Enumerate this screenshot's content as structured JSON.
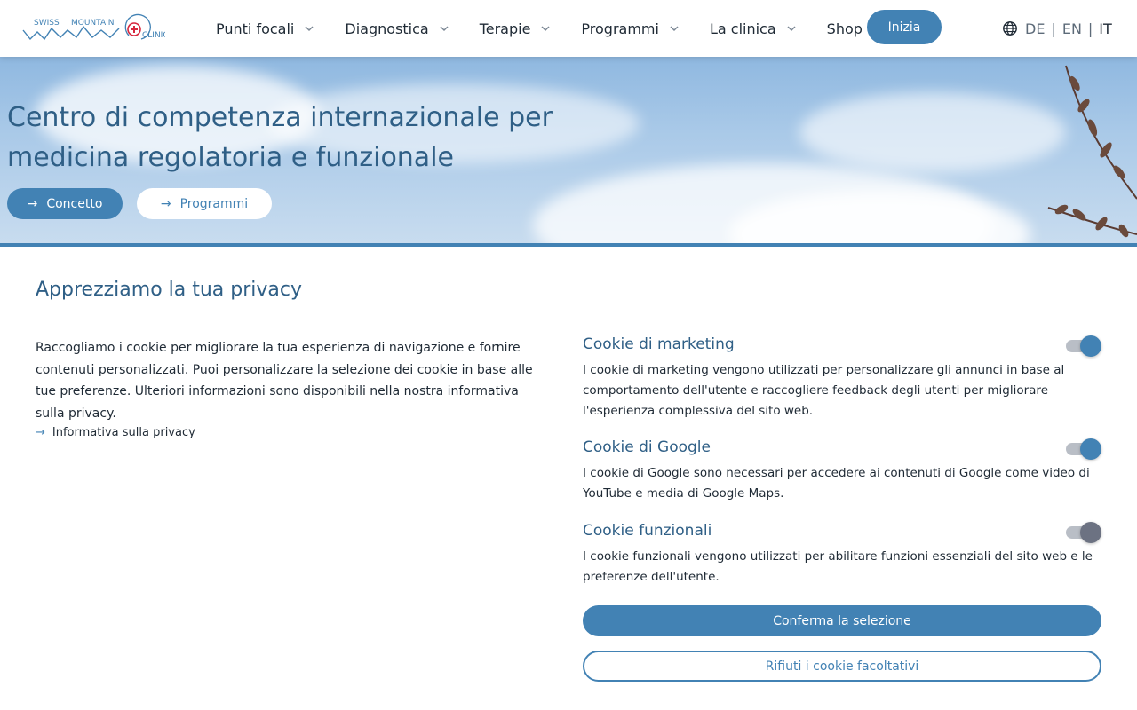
{
  "logo": {
    "text_parts": [
      "SWISS",
      "MOUNTAIN",
      "CLINIC"
    ]
  },
  "nav": {
    "items": [
      {
        "label": "Punti focali",
        "has_dropdown": true
      },
      {
        "label": "Diagnostica",
        "has_dropdown": true
      },
      {
        "label": "Terapie",
        "has_dropdown": true
      },
      {
        "label": "Programmi",
        "has_dropdown": true
      },
      {
        "label": "La clinica",
        "has_dropdown": true
      },
      {
        "label": "Shop",
        "has_dropdown": false
      }
    ],
    "start_label": "Inizia"
  },
  "lang": {
    "options": [
      "DE",
      "EN",
      "IT"
    ],
    "active": "IT",
    "separator": "|"
  },
  "hero": {
    "title": "Centro di competenza internazionale per medicina regolatoria e funzionale",
    "primary_button": "Concetto",
    "secondary_button": "Programmi"
  },
  "privacy": {
    "title": "Apprezziamo la tua privacy",
    "text": "Raccogliamo i cookie per migliorare la tua esperienza di navigazione e fornire contenuti personalizzati. Puoi personalizzare la selezione dei cookie in base alle tue preferenze. Ulteriori informazioni sono disponibili nella nostra informativa sulla privacy.",
    "link_label": "Informativa sulla privacy",
    "cookies": [
      {
        "title": "Cookie di marketing",
        "description": "I cookie di marketing vengono utilizzati per personalizzare gli annunci in base al comportamento dell'utente e raccogliere feedback degli utenti per migliorare l'esperienza complessiva del sito web.",
        "enabled": true
      },
      {
        "title": "Cookie di Google",
        "description": "I cookie di Google sono necessari per accedere ai contenuti di Google come video di YouTube e media di Google Maps.",
        "enabled": true
      },
      {
        "title": "Cookie funzionali",
        "description": "I cookie funzionali vengono utilizzati per abilitare funzioni essenziali del sito web e le preferenze dell'utente.",
        "enabled": true
      }
    ],
    "confirm_label": "Conferma la selezione",
    "reject_label": "Rifiuti i cookie facoltativi"
  },
  "colors": {
    "accent": "#4282b4",
    "title": "#2f5f86",
    "text": "#1f2a35",
    "toggle_locked": "#6c7282"
  }
}
